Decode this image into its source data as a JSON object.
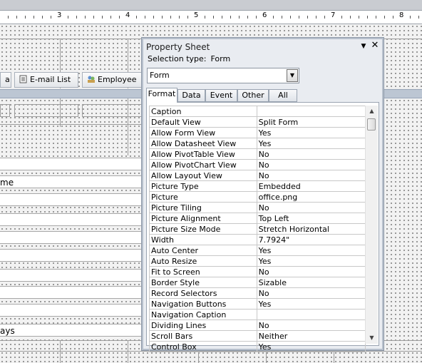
{
  "ruler": {
    "numbers": [
      "3",
      "4",
      "5",
      "6",
      "7",
      "8"
    ]
  },
  "form_design": {
    "tab_buttons": [
      {
        "label": "a",
        "icon": "none"
      },
      {
        "label": "E-mail List",
        "icon": "email-list-icon"
      },
      {
        "label": "Employee",
        "icon": "employee-icon"
      }
    ],
    "field_texts": [
      "me",
      "ays"
    ]
  },
  "property_sheet": {
    "title": "Property Sheet",
    "selection_label": "Selection type:",
    "selection_value": "Form",
    "combo_value": "Form",
    "tabs": [
      "Format",
      "Data",
      "Event",
      "Other",
      "All"
    ],
    "active_tab": "Format",
    "properties": [
      {
        "name": "Caption",
        "value": ""
      },
      {
        "name": "Default View",
        "value": "Split Form"
      },
      {
        "name": "Allow Form View",
        "value": "Yes"
      },
      {
        "name": "Allow Datasheet View",
        "value": "Yes"
      },
      {
        "name": "Allow PivotTable View",
        "value": "No"
      },
      {
        "name": "Allow PivotChart View",
        "value": "No"
      },
      {
        "name": "Allow Layout View",
        "value": "No"
      },
      {
        "name": "Picture Type",
        "value": "Embedded"
      },
      {
        "name": "Picture",
        "value": "office.png"
      },
      {
        "name": "Picture Tiling",
        "value": "No"
      },
      {
        "name": "Picture Alignment",
        "value": "Top Left"
      },
      {
        "name": "Picture Size Mode",
        "value": "Stretch Horizontal"
      },
      {
        "name": "Width",
        "value": "7.7924\""
      },
      {
        "name": "Auto Center",
        "value": "Yes"
      },
      {
        "name": "Auto Resize",
        "value": "Yes"
      },
      {
        "name": "Fit to Screen",
        "value": "No"
      },
      {
        "name": "Border Style",
        "value": "Sizable"
      },
      {
        "name": "Record Selectors",
        "value": "No"
      },
      {
        "name": "Navigation Buttons",
        "value": "Yes"
      },
      {
        "name": "Navigation Caption",
        "value": ""
      },
      {
        "name": "Dividing Lines",
        "value": "No"
      },
      {
        "name": "Scroll Bars",
        "value": "Neither"
      },
      {
        "name": "Control Box",
        "value": "Yes"
      }
    ]
  },
  "colors": {
    "section_bar": "#bcc6d3",
    "panel_border": "#b7c0cc"
  }
}
